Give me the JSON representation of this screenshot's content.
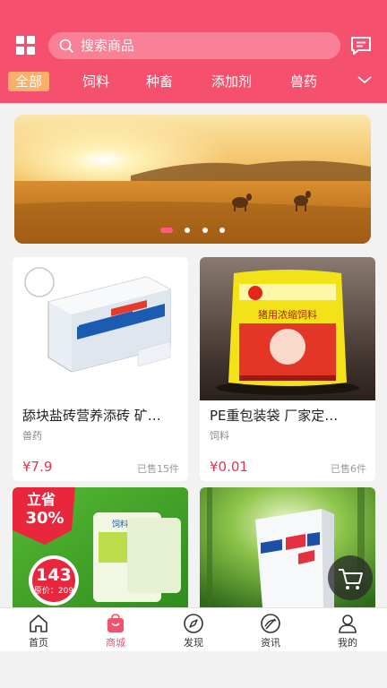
{
  "header": {
    "search_placeholder": "搜索商品",
    "tabs": [
      "全部",
      "饲料",
      "种畜",
      "添加剂",
      "兽药"
    ],
    "active_tab": "全部"
  },
  "banner": {
    "slide_count": 4,
    "active_slide": 1
  },
  "products": [
    {
      "title": "舔块盐砖营养添砖 矿…",
      "category": "兽药",
      "price": "¥7.9",
      "sold": "已售15件"
    },
    {
      "title": "PE重包装袋 厂家定…",
      "category": "饲料",
      "price": "¥0.01",
      "sold": "已售6件"
    },
    {
      "badge_top": "立省",
      "badge_pct": "30%",
      "price_big": "143",
      "orig_price": "原价：209",
      "pkg_brand": "饲料"
    }
  ],
  "product2_label": "猪用浓缩饲料",
  "tabbar": {
    "items": [
      {
        "label": "首页",
        "icon": "home-icon"
      },
      {
        "label": "商城",
        "icon": "shop-bag-icon"
      },
      {
        "label": "发现",
        "icon": "compass-icon"
      },
      {
        "label": "资讯",
        "icon": "news-icon"
      },
      {
        "label": "我的",
        "icon": "user-icon"
      }
    ],
    "active": "商城"
  },
  "colors": {
    "brand": "#f6506f",
    "price": "#e8344f",
    "active_tab_bg": "#f9b06a"
  }
}
